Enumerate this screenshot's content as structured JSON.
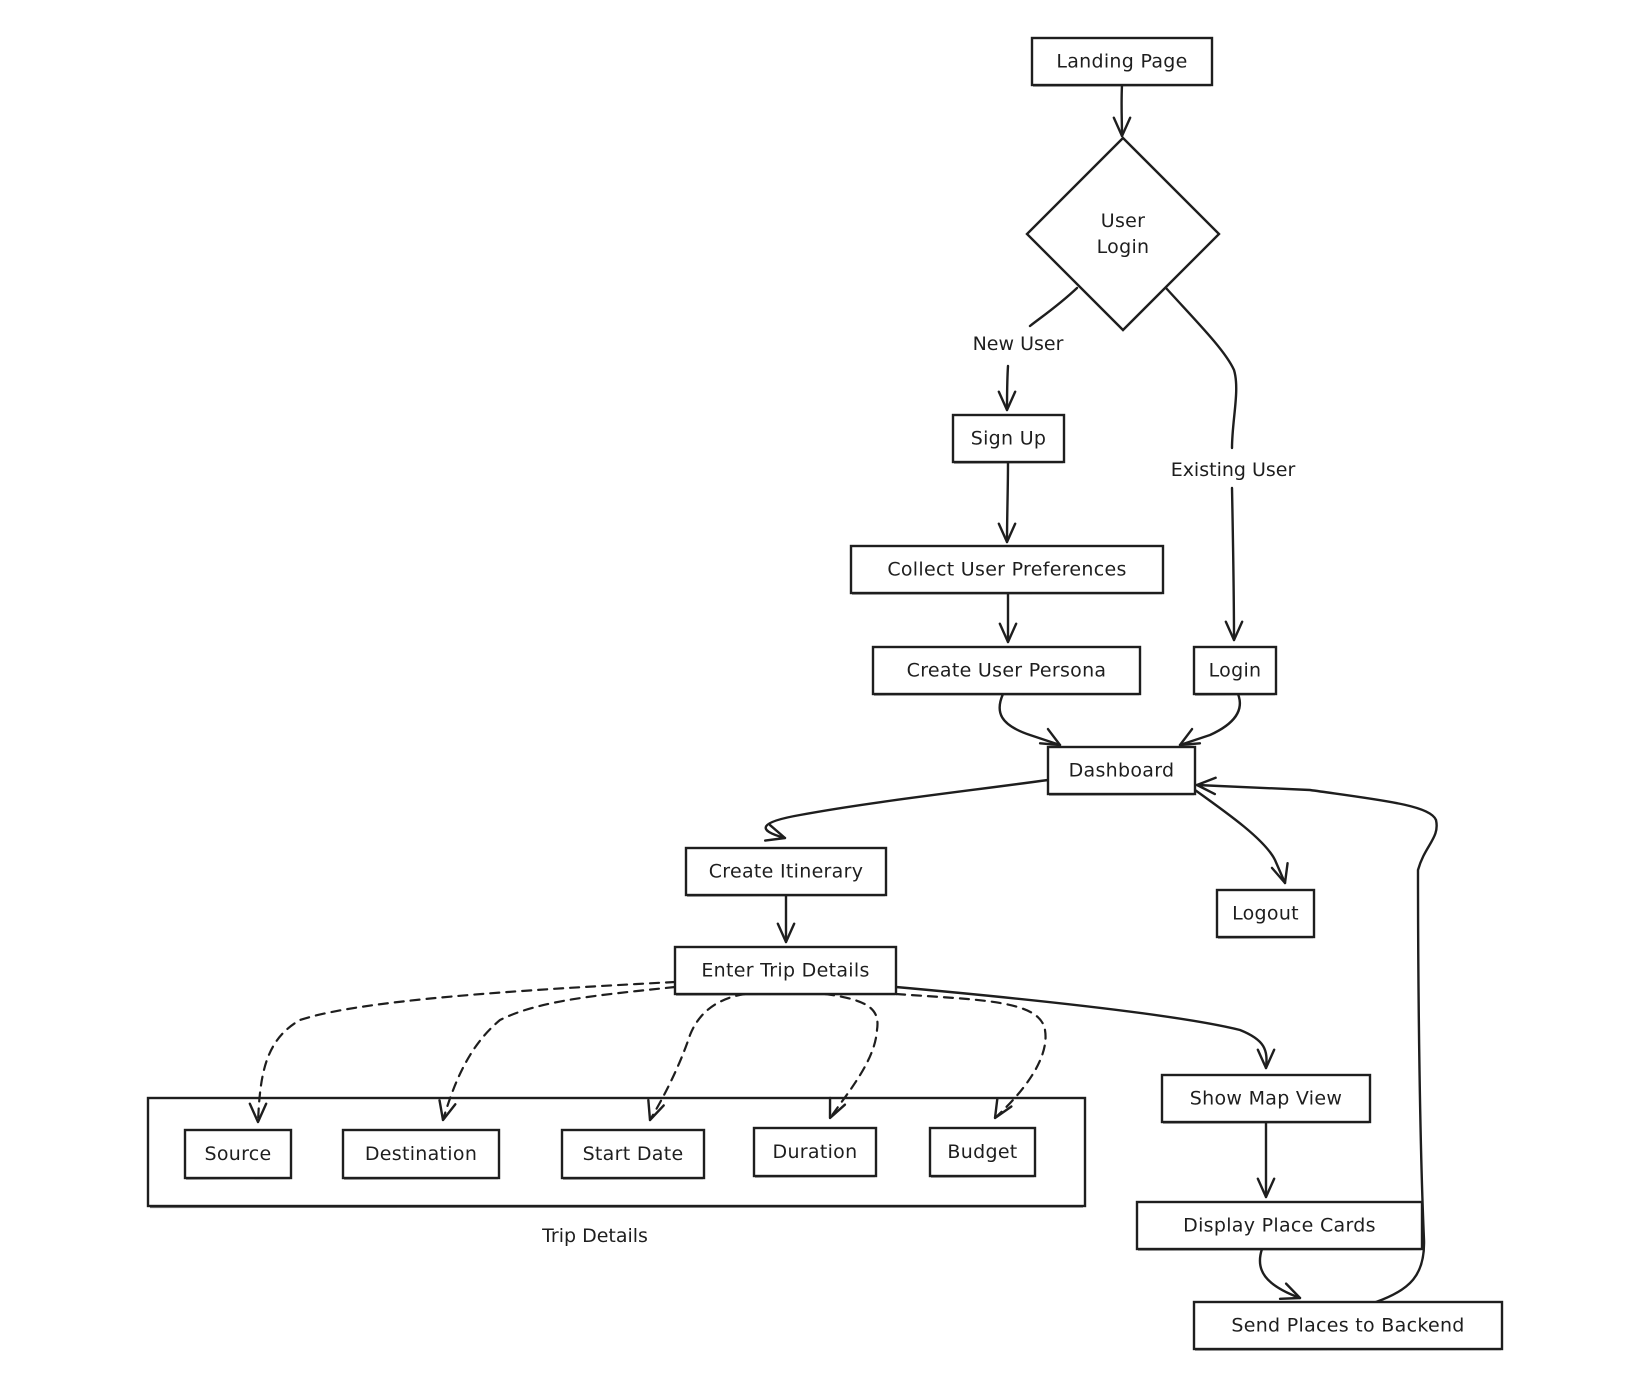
{
  "diagram": {
    "type": "flowchart",
    "style": "hand-drawn",
    "colors": {
      "stroke": "#1e1e1e",
      "background": "#ffffff"
    },
    "nodes": [
      {
        "id": "landing",
        "label": "Landing Page",
        "shape": "rect"
      },
      {
        "id": "user_login",
        "label": "User\nLogin",
        "shape": "diamond"
      },
      {
        "id": "sign_up",
        "label": "Sign Up",
        "shape": "rect"
      },
      {
        "id": "collect_prefs",
        "label": "Collect User Preferences",
        "shape": "rect"
      },
      {
        "id": "create_persona",
        "label": "Create User Persona",
        "shape": "rect"
      },
      {
        "id": "login",
        "label": "Login",
        "shape": "rect"
      },
      {
        "id": "dashboard",
        "label": "Dashboard",
        "shape": "rect"
      },
      {
        "id": "create_itinerary",
        "label": "Create Itinerary",
        "shape": "rect"
      },
      {
        "id": "logout",
        "label": "Logout",
        "shape": "rect"
      },
      {
        "id": "enter_trip",
        "label": "Enter Trip Details",
        "shape": "rect"
      },
      {
        "id": "source",
        "label": "Source",
        "shape": "rect",
        "group": "trip_details"
      },
      {
        "id": "destination",
        "label": "Destination",
        "shape": "rect",
        "group": "trip_details"
      },
      {
        "id": "start_date",
        "label": "Start Date",
        "shape": "rect",
        "group": "trip_details"
      },
      {
        "id": "duration",
        "label": "Duration",
        "shape": "rect",
        "group": "trip_details"
      },
      {
        "id": "budget",
        "label": "Budget",
        "shape": "rect",
        "group": "trip_details"
      },
      {
        "id": "map_view",
        "label": "Show Map View",
        "shape": "rect"
      },
      {
        "id": "place_cards",
        "label": "Display Place Cards",
        "shape": "rect"
      },
      {
        "id": "send_backend",
        "label": "Send Places to Backend",
        "shape": "rect"
      }
    ],
    "groups": [
      {
        "id": "trip_details",
        "label": "Trip Details"
      }
    ],
    "edges": [
      {
        "id": "e1",
        "from": "landing",
        "to": "user_login",
        "label": "",
        "style": "solid"
      },
      {
        "id": "e2",
        "from": "user_login",
        "to": "sign_up",
        "label": "New User",
        "style": "solid"
      },
      {
        "id": "e3",
        "from": "user_login",
        "to": "login",
        "label": "Existing User",
        "style": "solid"
      },
      {
        "id": "e4",
        "from": "sign_up",
        "to": "collect_prefs",
        "label": "",
        "style": "solid"
      },
      {
        "id": "e5",
        "from": "collect_prefs",
        "to": "create_persona",
        "label": "",
        "style": "solid"
      },
      {
        "id": "e6",
        "from": "create_persona",
        "to": "dashboard",
        "label": "",
        "style": "solid"
      },
      {
        "id": "e7",
        "from": "login",
        "to": "dashboard",
        "label": "",
        "style": "solid"
      },
      {
        "id": "e8",
        "from": "dashboard",
        "to": "create_itinerary",
        "label": "",
        "style": "solid"
      },
      {
        "id": "e9",
        "from": "dashboard",
        "to": "logout",
        "label": "",
        "style": "solid"
      },
      {
        "id": "e10",
        "from": "create_itinerary",
        "to": "enter_trip",
        "label": "",
        "style": "solid"
      },
      {
        "id": "e11",
        "from": "enter_trip",
        "to": "source",
        "label": "",
        "style": "dashed"
      },
      {
        "id": "e12",
        "from": "enter_trip",
        "to": "destination",
        "label": "",
        "style": "dashed"
      },
      {
        "id": "e13",
        "from": "enter_trip",
        "to": "start_date",
        "label": "",
        "style": "dashed"
      },
      {
        "id": "e14",
        "from": "enter_trip",
        "to": "duration",
        "label": "",
        "style": "dashed"
      },
      {
        "id": "e15",
        "from": "enter_trip",
        "to": "budget",
        "label": "",
        "style": "dashed"
      },
      {
        "id": "e16",
        "from": "enter_trip",
        "to": "map_view",
        "label": "",
        "style": "solid"
      },
      {
        "id": "e17",
        "from": "map_view",
        "to": "place_cards",
        "label": "",
        "style": "solid"
      },
      {
        "id": "e18",
        "from": "place_cards",
        "to": "send_backend",
        "label": "",
        "style": "solid"
      },
      {
        "id": "e19",
        "from": "send_backend",
        "to": "dashboard",
        "label": "",
        "style": "solid"
      }
    ]
  }
}
